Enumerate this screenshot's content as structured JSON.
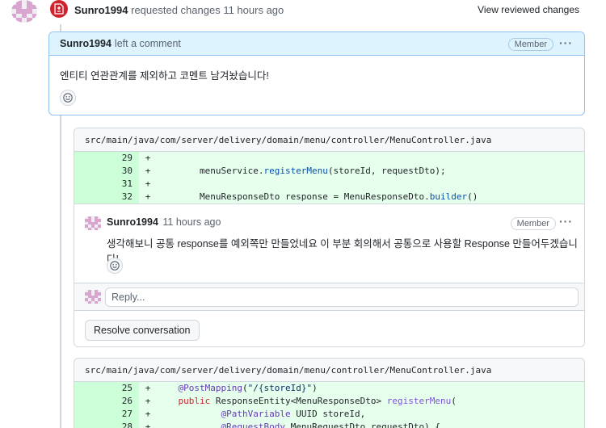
{
  "review": {
    "author": "Sunro1994",
    "action": "requested changes",
    "time": "11 hours ago",
    "view_changes_label": "View reviewed changes"
  },
  "main_comment": {
    "author": "Sunro1994",
    "action": "left a comment",
    "badge": "Member",
    "menu": "···",
    "body": "엔티티 연관관계를 제외하고 코멘트 남겨놨습니다!"
  },
  "file1": {
    "path": "src/main/java/com/server/delivery/domain/menu/controller/MenuController.java",
    "lines": [
      {
        "num": "29",
        "sign": "+",
        "code": ""
      },
      {
        "num": "30",
        "sign": "+",
        "code": "        menuService.registerMenu(storeId, requestDto);"
      },
      {
        "num": "31",
        "sign": "+",
        "code": ""
      },
      {
        "num": "32",
        "sign": "+",
        "code": "        MenuResponseDto response = MenuResponseDto.builder()"
      }
    ]
  },
  "thread": {
    "author": "Sunro1994",
    "time": "11 hours ago",
    "badge": "Member",
    "menu": "···",
    "body": "생각해보니 공통 response를 예외쪽만 만들었네요 이 부분 회의해서 공통으로 사용할 Response 만들어두겠습니다!",
    "reply_placeholder": "Reply...",
    "resolve_label": "Resolve conversation"
  },
  "file2": {
    "path": "src/main/java/com/server/delivery/domain/menu/controller/MenuController.java",
    "lines": [
      {
        "num": "25",
        "sign": "+",
        "code": "    @PostMapping(\"/{storeId}\")"
      },
      {
        "num": "26",
        "sign": "+",
        "code": "    public ResponseEntity<MenuResponseDto> registerMenu("
      },
      {
        "num": "27",
        "sign": "+",
        "code": "            @PathVariable UUID storeId,"
      },
      {
        "num": "28",
        "sign": "+",
        "code": "            @RequestBody MenuRequestDto requestDto) {"
      }
    ]
  },
  "icons": {
    "review_badge": "file-diff-icon",
    "reaction": "smiley-icon",
    "menu": "kebab-horizontal-icon"
  },
  "colors": {
    "requested_changes": "#cf222e",
    "comment_header": "#ddf4ff",
    "added_line": "#e6ffec",
    "added_line_number": "#ccffd8"
  }
}
